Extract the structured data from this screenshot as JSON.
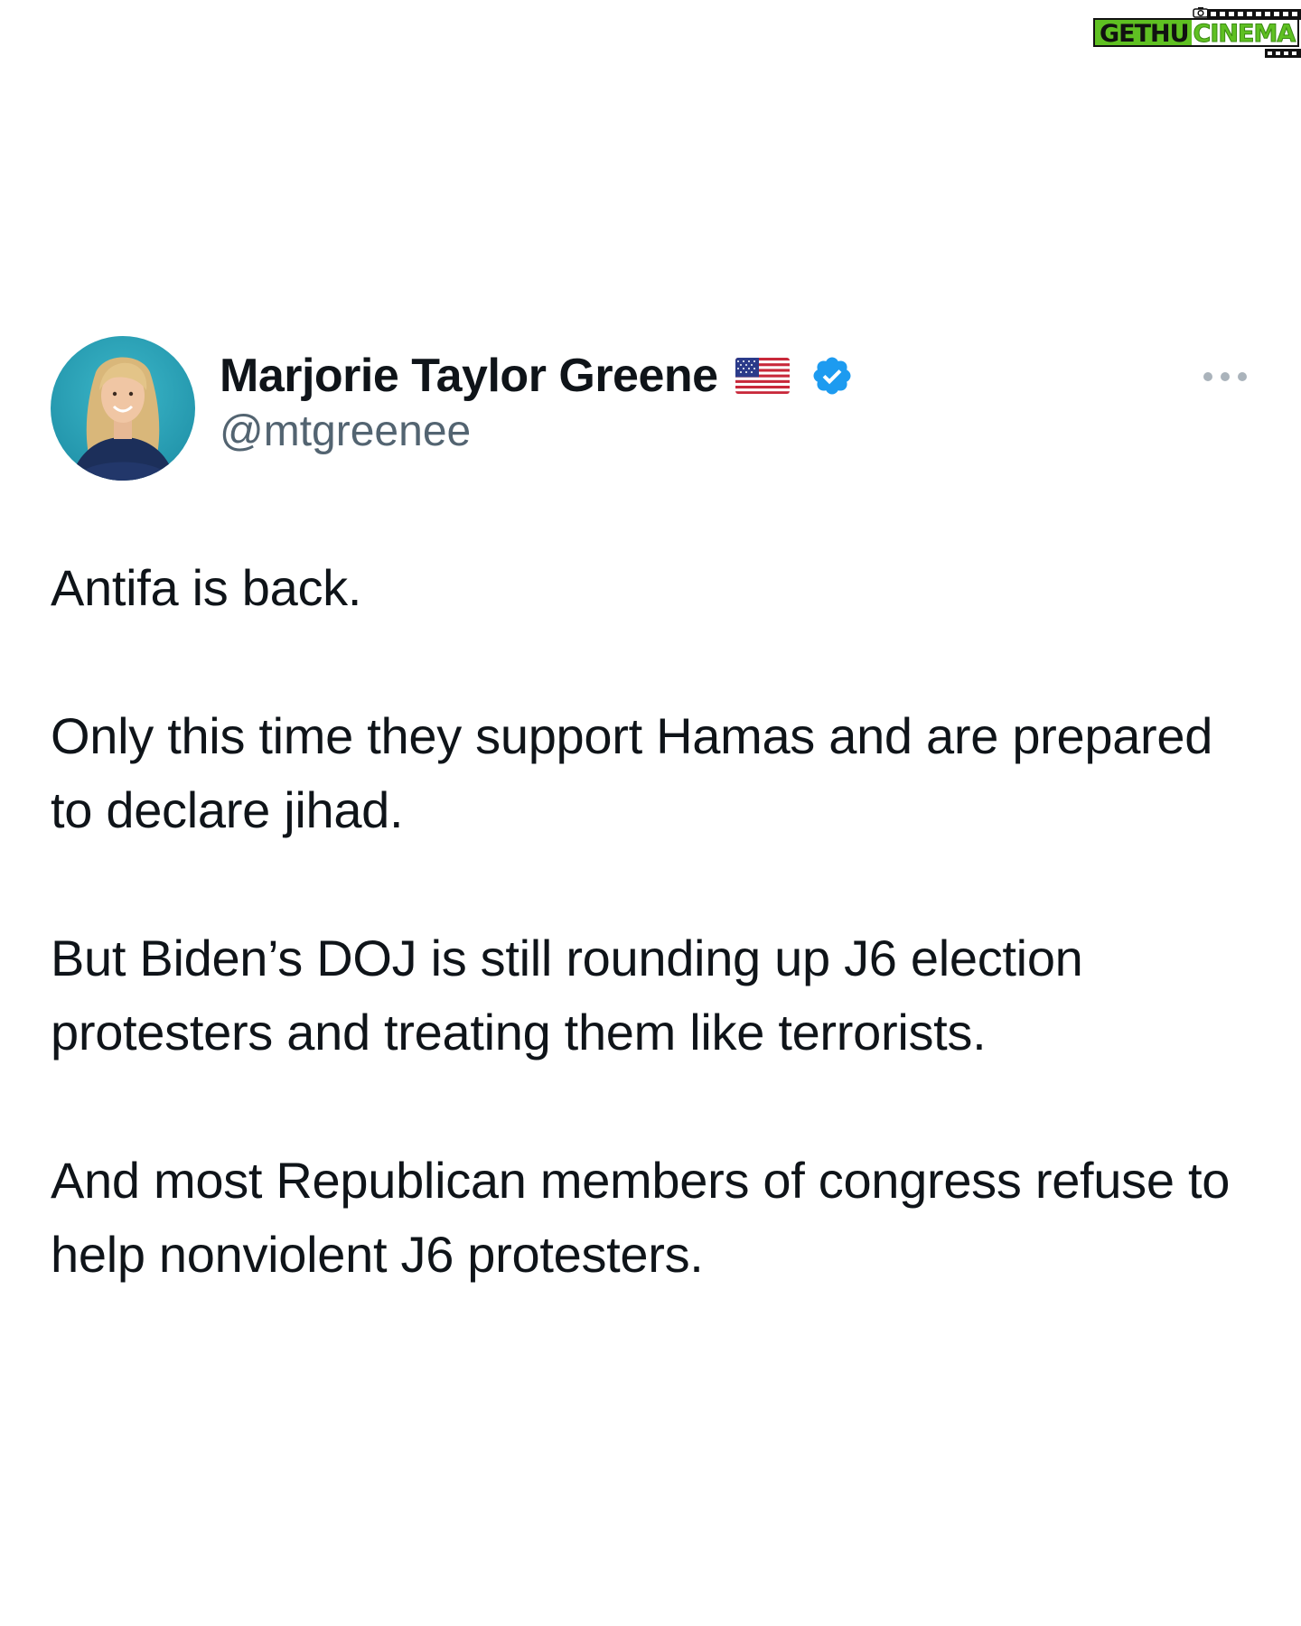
{
  "watermark": {
    "part1": "GETHU",
    "part2": "CINEMA",
    "icon": "camera-film-logo"
  },
  "tweet": {
    "author": {
      "display_name": "Marjorie Taylor Greene",
      "handle": "@mtgreenee",
      "flag_icon": "us-flag-icon",
      "verified_icon": "verified-badge-icon",
      "verified_color": "#1d9bf0",
      "avatar_bg": "#2aa3b8"
    },
    "more_icon": "more-options-icon",
    "paragraphs": [
      "Antifa is back.",
      "Only this time they support Hamas and are prepared to declare jihad.",
      "But Biden’s DOJ is still rounding up J6 election protesters and treating them like terrorists.",
      "And most Republican members of congress refuse to help nonviolent J6 protesters."
    ]
  }
}
